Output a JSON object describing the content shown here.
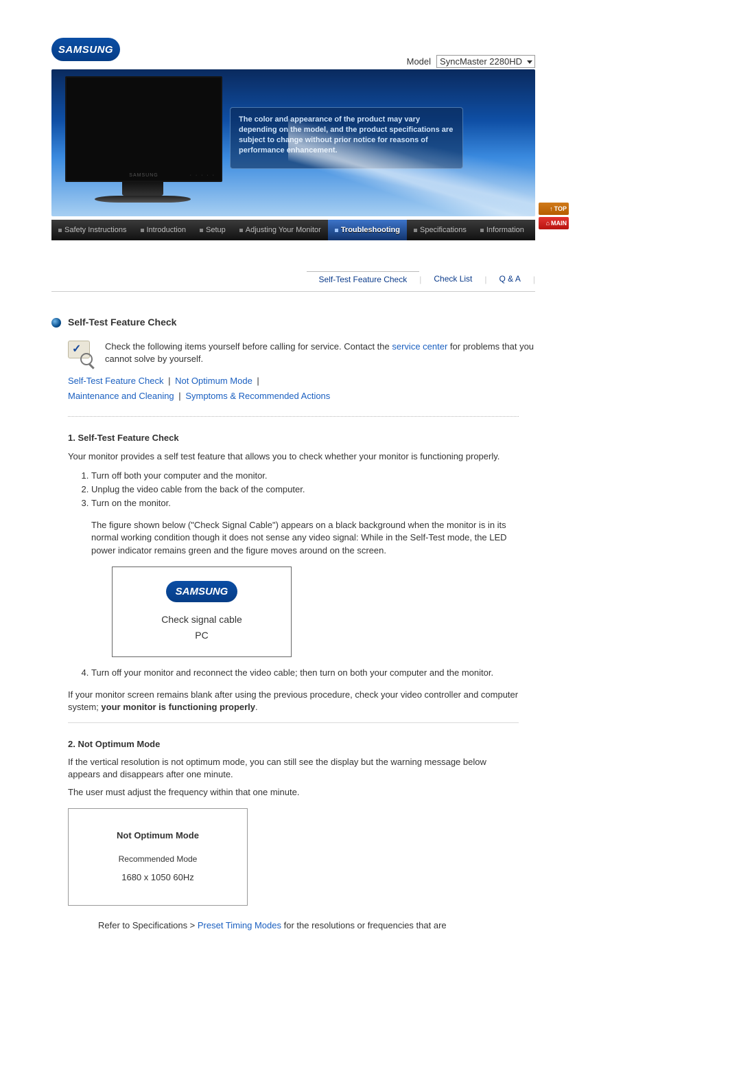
{
  "logo_text": "SAMSUNG",
  "model_label": "Model",
  "model_value": "SyncMaster 2280HD",
  "banner_message": "The color and appearance of the product may vary depending on the model, and the product specifications are subject to change without prior notice for reasons of performance enhancement.",
  "nav": {
    "items": [
      {
        "label": "Safety Instructions"
      },
      {
        "label": "Introduction"
      },
      {
        "label": "Setup"
      },
      {
        "label": "Adjusting Your Monitor"
      },
      {
        "label": "Troubleshooting",
        "active": true
      },
      {
        "label": "Specifications"
      },
      {
        "label": "Information"
      }
    ]
  },
  "side": {
    "top": "TOP",
    "main": "MAIN"
  },
  "subnav": {
    "items": [
      {
        "label": "Self-Test Feature Check",
        "active": true
      },
      {
        "label": "Check List"
      },
      {
        "label": "Q & A"
      }
    ]
  },
  "section_title": "Self-Test Feature Check",
  "intro_pre": "Check the following items yourself before calling for service. Contact the ",
  "intro_link": "service center",
  "intro_post": " for problems that you cannot solve by yourself.",
  "quicklinks": {
    "stfc": "Self-Test Feature Check",
    "notopt": "Not Optimum Mode",
    "maint": "Maintenance and Cleaning",
    "symp": "Symptoms & Recommended Actions"
  },
  "s1": {
    "title": "1. Self-Test Feature Check",
    "p1": "Your monitor provides a self test feature that allows you to check whether your monitor is functioning properly.",
    "step1": "Turn off both your computer and the monitor.",
    "step2": "Unplug the video cable from the back of the computer.",
    "step3": "Turn on the monitor.",
    "step3_note": "The figure shown below (\"Check Signal Cable\") appears on a black background when the monitor is in its normal working condition though it does not sense any video signal: While in the Self-Test mode, the LED power indicator remains green and the figure moves around on the screen.",
    "box_logo": "SAMSUNG",
    "box_line1": "Check signal cable",
    "box_line2": "PC",
    "step4": "Turn off your monitor and reconnect the video cable; then turn on both your computer and the monitor.",
    "closing_pre": "If your monitor screen remains blank after using the previous procedure, check your video controller and computer system; ",
    "closing_bold": "your monitor is functioning properly",
    "closing_post": "."
  },
  "s2": {
    "title": "2. Not Optimum Mode",
    "p1": "If the vertical resolution is not optimum mode, you can still see the display but the warning message below appears and disappears after one minute.",
    "p2": "The user must adjust the frequency within that one minute.",
    "box_t": "Not Optimum Mode",
    "box_r": "Recommended Mode",
    "box_m": "1680 x 1050  60Hz",
    "foot_pre": "Refer to Specifications > ",
    "foot_link": "Preset Timing Modes",
    "foot_post": " for the resolutions or frequencies that are"
  }
}
